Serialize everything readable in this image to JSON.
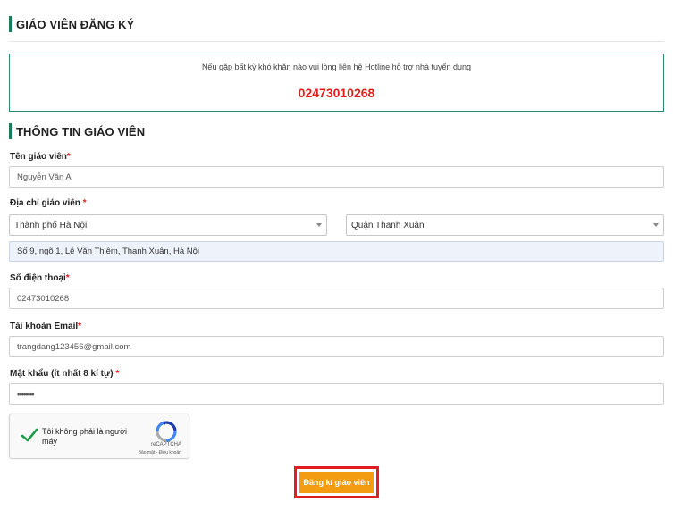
{
  "header": {
    "title": "GIÁO VIÊN ĐĂNG KÝ"
  },
  "notice": {
    "message": "Nếu gặp bất kỳ khó khăn nào vui lòng liên hệ Hotline hỗ trợ nhà tuyển dụng",
    "hotline": "02473010268"
  },
  "section": {
    "title": "THÔNG TIN GIÁO VIÊN"
  },
  "form": {
    "name": {
      "label": "Tên giáo viên",
      "required_mark": "*",
      "value": "Nguyễn Văn A"
    },
    "address": {
      "label": "Địa chỉ giáo viên ",
      "required_mark": "*",
      "city": "Thành phố Hà Nội",
      "district": "Quận Thanh Xuân",
      "street": "Số 9, ngõ 1, Lê Văn Thiêm, Thanh Xuân, Hà Nội"
    },
    "phone": {
      "label": "Số điện thoại",
      "required_mark": "*",
      "value": "02473010268"
    },
    "email": {
      "label": "Tài khoản Email",
      "required_mark": "*",
      "value": "trangdang123456@gmail.com"
    },
    "password": {
      "label": "Mật khẩu (ít nhất 8 kí tự) ",
      "required_mark": "*",
      "value": "••••••••"
    }
  },
  "captcha": {
    "text": "Tôi không phải là người máy",
    "brand": "reCAPTCHA",
    "links": "Bảo mật - Điều khoản",
    "checked": true
  },
  "submit": {
    "label": "Đăng kí giáo viên"
  },
  "colors": {
    "accent": "#1a7a5a",
    "hotline": "#e01e1e",
    "button": "#f39c12",
    "button_outline": "#e41d25"
  }
}
